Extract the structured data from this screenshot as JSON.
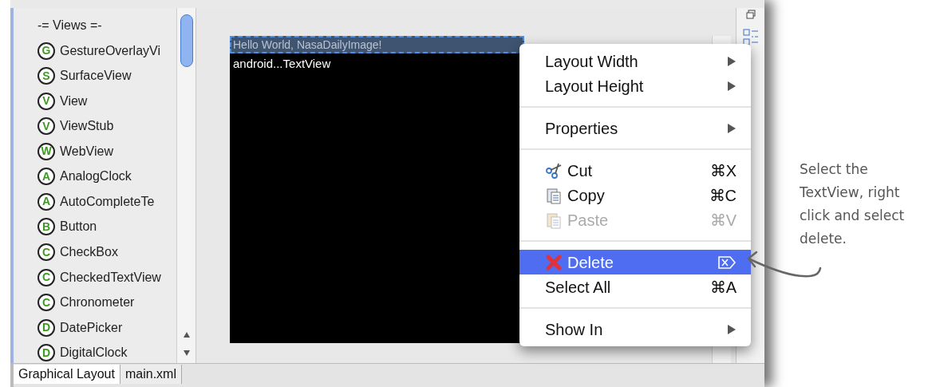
{
  "palette": {
    "heading": "-= Views =-",
    "items": [
      {
        "letter": "G",
        "label": "GestureOverlayVi"
      },
      {
        "letter": "S",
        "label": "SurfaceView"
      },
      {
        "letter": "V",
        "label": "View"
      },
      {
        "letter": "V",
        "label": "ViewStub"
      },
      {
        "letter": "W",
        "label": "WebView"
      },
      {
        "letter": "A",
        "label": "AnalogClock"
      },
      {
        "letter": "A",
        "label": "AutoCompleteTe"
      },
      {
        "letter": "B",
        "label": "Button"
      },
      {
        "letter": "C",
        "label": "CheckBox"
      },
      {
        "letter": "C",
        "label": "CheckedTextView"
      },
      {
        "letter": "C",
        "label": "Chronometer"
      },
      {
        "letter": "D",
        "label": "DatePicker"
      },
      {
        "letter": "D",
        "label": "DigitalClock"
      }
    ]
  },
  "canvas": {
    "selected_view": {
      "text": "Hello World, NasaDailyImage!",
      "selected": true
    },
    "hint": "android...TextView"
  },
  "context_menu": [
    {
      "kind": "submenu",
      "label": "Layout Width",
      "disabled": false,
      "selected": false
    },
    {
      "kind": "submenu",
      "label": "Layout Height",
      "disabled": false,
      "selected": false
    },
    {
      "kind": "separator"
    },
    {
      "kind": "submenu",
      "label": "Properties",
      "disabled": false,
      "selected": false
    },
    {
      "kind": "separator"
    },
    {
      "kind": "cut",
      "label": "Cut",
      "shortcut": "⌘X",
      "disabled": false,
      "selected": false
    },
    {
      "kind": "copy",
      "label": "Copy",
      "shortcut": "⌘C",
      "disabled": false,
      "selected": false
    },
    {
      "kind": "paste",
      "label": "Paste",
      "shortcut": "⌘V",
      "disabled": true,
      "selected": false
    },
    {
      "kind": "separator"
    },
    {
      "kind": "delete",
      "label": "Delete",
      "disabled": false,
      "selected": true
    },
    {
      "kind": "plain",
      "label": "Select All",
      "shortcut": "⌘A",
      "disabled": false,
      "selected": false
    },
    {
      "kind": "separator"
    },
    {
      "kind": "submenu",
      "label": "Show In",
      "disabled": false,
      "selected": false
    }
  ],
  "tabs": [
    {
      "label": "Graphical Layout",
      "selected": true
    },
    {
      "label": "main.xml",
      "selected": false
    }
  ],
  "annotation": {
    "text": "Select the TextView, right click and select delete."
  }
}
